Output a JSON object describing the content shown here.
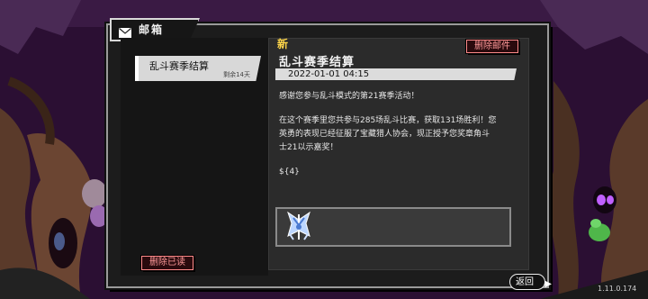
{
  "mailbox": {
    "title": "邮箱",
    "title_icon": "envelope-icon",
    "delete_read_label": "删除已读"
  },
  "mail_list": [
    {
      "subject": "乱斗赛季结算",
      "remaining": "剩余14天",
      "selected": true
    }
  ],
  "mail_detail": {
    "new_tag": "新",
    "delete_label": "删除邮件",
    "title": "乱斗赛季结算",
    "date": "2022-01-01 04:15",
    "paragraph_1": "感谢您参与乱斗模式的第21赛季活动！",
    "paragraph_2_line_1": "在这个赛季里您共参与285场乱斗比赛，获取131场胜利！您",
    "paragraph_2_line_2": "英勇的表现已经征服了宝藏猎人协会，现正授予您奖章角斗",
    "paragraph_2_line_3": "士21以示嘉奖！",
    "placeholder": "${4}",
    "attachment_icon": "gladiator-medal-icon"
  },
  "footer": {
    "back_label": "返回",
    "version": "1.11.0.174"
  },
  "colors": {
    "accent_red": "#ff8a8a",
    "new_yellow": "#ffd64a",
    "background_purple": "#2a1030"
  }
}
